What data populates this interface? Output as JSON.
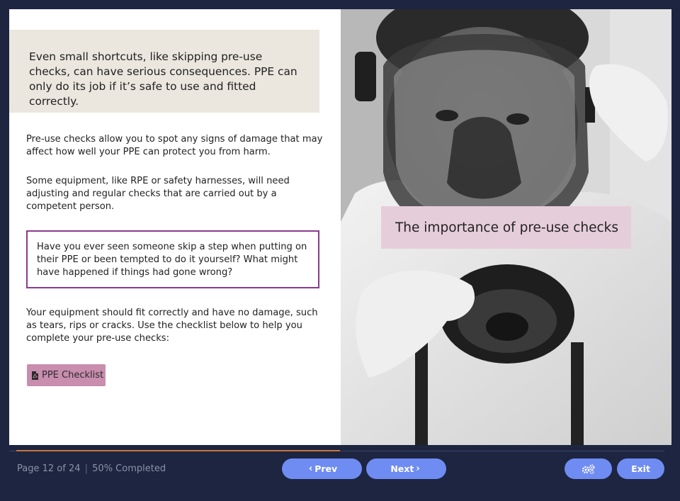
{
  "content": {
    "callout": "Even small shortcuts, like skipping pre-use checks, can have serious consequences. PPE can only do its job if it’s safe to use and fitted correctly.",
    "para1": "Pre-use checks allow you to spot any signs of damage that may affect how well your PPE can protect you from harm.",
    "para2": "Some equipment, like RPE or safety harnesses, will need adjusting and regular checks that are carried out by a competent person.",
    "question": "Have you ever seen someone skip a step when putting on their PPE or been tempted to do it yourself? What might have happened if things had gone wrong?",
    "para3": "Your equipment should fit correctly and have no damage, such as tears, rips or cracks. Use the checklist below to help you complete your pre-use checks:",
    "checklist_label": "PPE Checklist",
    "checklist_icon": "file-pdf-icon",
    "title_card": "The importance of pre-use checks"
  },
  "footer": {
    "page_text": "Page 12 of 24",
    "separator": "|",
    "completed_text": "50% Completed",
    "progress_percent": 50,
    "prev_label": "Prev",
    "next_label": "Next",
    "settings_icon": "gears-icon",
    "exit_label": "Exit"
  },
  "colors": {
    "background": "#1d2540",
    "accent_button": "#6f8cf2",
    "checklist_button": "#c98dae",
    "question_border": "#8a3a8f",
    "title_card_bg": "#e6cdda",
    "callout_bg": "#ebe7df",
    "progress": "#c8763a"
  }
}
